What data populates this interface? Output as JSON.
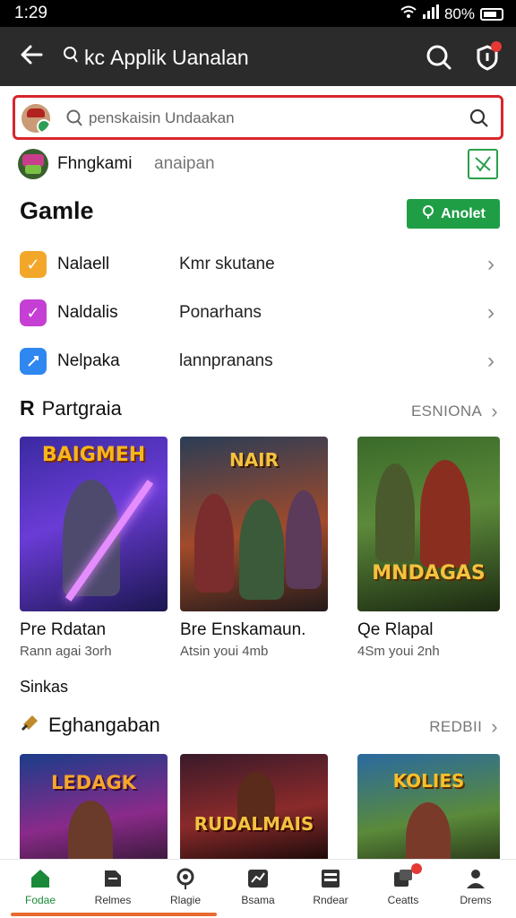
{
  "status_bar": {
    "time": "1:29",
    "battery_text": "80%"
  },
  "app_bar": {
    "title": "Applik Uanalan",
    "prefix": "kc"
  },
  "search": {
    "placeholder": "penskaisin Undaakan"
  },
  "suggestion": {
    "title": "Fhngkami",
    "subtitle": "anaipan"
  },
  "games": {
    "title": "Gamle",
    "analyze_label": "Anolet",
    "rows": [
      {
        "name": "Nalaell",
        "value": "Kmr skutane",
        "icon": "check-icon",
        "color": "#f2a72b"
      },
      {
        "name": "Naldalis",
        "value": "Ponarhans",
        "icon": "check-icon",
        "color": "#c53fd4"
      },
      {
        "name": "Nelpaka",
        "value": "lannpranans",
        "icon": "rocket-icon",
        "color": "#2f87f0"
      }
    ]
  },
  "section_popular": {
    "title": "Partgraia",
    "more_label": "ESNIONA",
    "cards": [
      {
        "thumb_text": "BAIGMEH",
        "title": "Pre Rdatan",
        "subtitle": "Rann agai 3orh"
      },
      {
        "thumb_text": "NAIR",
        "title": "Bre Enskamaun.",
        "subtitle": "Atsin youi 4mb"
      },
      {
        "thumb_text": "MNDAGAS",
        "title": "Qe Rlapal",
        "subtitle": "4Sm youi 2nh"
      }
    ]
  },
  "label_small": "Sinkas",
  "section_second": {
    "title": "Eghangaban",
    "more_label": "REDBII",
    "cards": [
      {
        "thumb_text": "LEDAGK"
      },
      {
        "thumb_text": "RUDALMAIS"
      },
      {
        "thumb_text": "KOLIES"
      }
    ]
  },
  "bottom_nav": [
    {
      "label": "Fodae",
      "icon": "home-icon",
      "active": true
    },
    {
      "label": "Relmes",
      "icon": "tag-icon",
      "active": false
    },
    {
      "label": "Rlagie",
      "icon": "pin-icon",
      "active": false
    },
    {
      "label": "Bsama",
      "icon": "chart-icon",
      "active": false
    },
    {
      "label": "Rndear",
      "icon": "grid-icon",
      "active": false
    },
    {
      "label": "Ceatts",
      "icon": "chat-icon",
      "active": false
    },
    {
      "label": "Drems",
      "icon": "user-icon",
      "active": false
    }
  ]
}
